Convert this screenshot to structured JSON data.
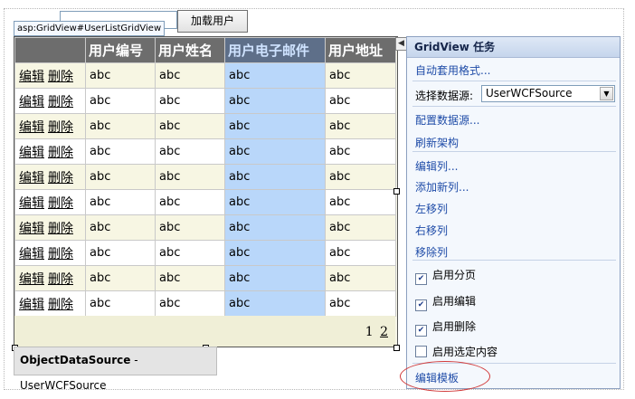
{
  "toolbar": {
    "load_button": "加载用户"
  },
  "grid": {
    "tag": "asp:GridView#UserListGridView",
    "headers": [
      "",
      "用户编号",
      "用户姓名",
      "用户电子邮件",
      "用户地址"
    ],
    "edit_label": "编辑",
    "delete_label": "删除",
    "rows": [
      [
        "abc",
        "abc",
        "abc",
        "abc"
      ],
      [
        "abc",
        "abc",
        "abc",
        "abc"
      ],
      [
        "abc",
        "abc",
        "abc",
        "abc"
      ],
      [
        "abc",
        "abc",
        "abc",
        "abc"
      ],
      [
        "abc",
        "abc",
        "abc",
        "abc"
      ],
      [
        "abc",
        "abc",
        "abc",
        "abc"
      ],
      [
        "abc",
        "abc",
        "abc",
        "abc"
      ],
      [
        "abc",
        "abc",
        "abc",
        "abc"
      ],
      [
        "abc",
        "abc",
        "abc",
        "abc"
      ],
      [
        "abc",
        "abc",
        "abc",
        "abc"
      ]
    ],
    "pager": {
      "current": "1",
      "next": "2"
    }
  },
  "ods": {
    "type": "ObjectDataSource",
    "sep": " - ",
    "name": "UserWCFSource"
  },
  "tasks": {
    "title": "GridView 任务",
    "auto_format": "自动套用格式...",
    "choose_ds_label": "选择数据源:",
    "choose_ds_value": "UserWCFSource",
    "configure_ds": "配置数据源...",
    "refresh_schema": "刷新架构",
    "edit_columns": "编辑列...",
    "add_column": "添加新列...",
    "move_left": "左移列",
    "move_right": "右移列",
    "remove_column": "移除列",
    "enable_paging": "启用分页",
    "enable_editing": "启用编辑",
    "enable_deleting": "启用删除",
    "enable_selection": "启用选定内容",
    "edit_templates": "编辑模板",
    "checks": {
      "paging": true,
      "editing": true,
      "deleting": true,
      "selection": false
    }
  },
  "icons": {
    "collapse": "chevron-left-icon",
    "dropdown": "chevron-down-icon",
    "check": "check-icon"
  },
  "colors": {
    "header_bg": "#6d6d6d",
    "selected_col": "#b9d7fa",
    "task_link": "#1f4ca8",
    "highlight": "#d23a3a"
  }
}
